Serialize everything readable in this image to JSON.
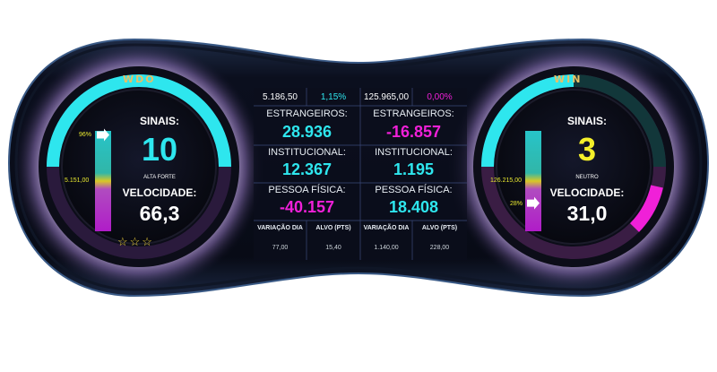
{
  "wdo": {
    "title": "WDO",
    "sinais_label": "SINAIS:",
    "sinais_value": "10",
    "signal_text": "ALTA FORTE",
    "velocidade_label": "VELOCIDADE:",
    "velocidade_value": "66,3",
    "bar_percent": "96%",
    "bar_price": "5.151,00",
    "arc_fraction": 0.5,
    "stars": "☆☆☆",
    "bar_percent_value": 0.96
  },
  "win": {
    "title": "WIN",
    "sinais_label": "SINAIS:",
    "sinais_value": "3",
    "signal_text": "NEUTRO",
    "velocidade_label": "VELOCIDADE:",
    "velocidade_value": "31,0",
    "bar_percent": "28%",
    "bar_price": "126.215,00",
    "bar_percent_value": 0.28
  },
  "table": {
    "left": {
      "price": "5.186,50",
      "change": "1,15%",
      "estrangeiros_label": "ESTRANGEIROS:",
      "estrangeiros_value": "28.936",
      "institucional_label": "INSTITUCIONAL:",
      "institucional_value": "12.367",
      "pessoa_fisica_label": "PESSOA FÍSICA:",
      "pessoa_fisica_value": "-40.157",
      "variacao_label": "VARIAÇÃO DIA",
      "alvo_label": "ALVO (PTS)",
      "variacao_value": "77,00",
      "alvo_value": "15,40"
    },
    "right": {
      "price": "125.965,00",
      "change": "0,00%",
      "estrangeiros_label": "ESTRANGEIROS:",
      "estrangeiros_value": "-16.857",
      "institucional_label": "INSTITUCIONAL:",
      "institucional_value": "1.195",
      "pessoa_fisica_label": "PESSOA FÍSICA:",
      "pessoa_fisica_value": "18.408",
      "variacao_label": "VARIAÇÃO DIA",
      "alvo_label": "ALVO (PTS)",
      "variacao_value": "1.140,00",
      "alvo_value": "228,00"
    }
  },
  "colors": {
    "cyan": "#2ee6ee",
    "magenta": "#f020d8",
    "yellow": "#f4ef2a",
    "gold": "#e7c067",
    "panel": "#0b0e1c"
  }
}
